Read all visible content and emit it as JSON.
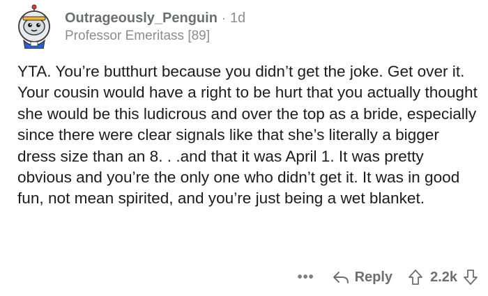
{
  "comment": {
    "author": "Outrageously_Penguin",
    "separator": "·",
    "age": "1d",
    "flair": "Professor Emeritass [89]",
    "body": "YTA. You’re butthurt because you didn’t get the joke. Get over it. Your cousin would have a right to be hurt that you actually thought she would be this ludicrous and over the top as a bride, especially since there were clear signals like that she’s literally a bigger dress size than an 8. . .and that it was April 1. It was pretty obvious and you’re the only one who didn’t get it. It was in good fun, not mean spirited, and you’re just being a wet blanket."
  },
  "actions": {
    "more_label": "•••",
    "reply_label": "Reply",
    "score": "2.2k"
  },
  "icons": {
    "avatar": "penguin-avatar-icon",
    "reply": "reply-arrow-icon",
    "upvote": "upvote-arrow-icon",
    "downvote": "downvote-arrow-icon"
  },
  "colors": {
    "text": "#1c1c1c",
    "meta": "#8a8d90",
    "username": "#6b6f72"
  }
}
